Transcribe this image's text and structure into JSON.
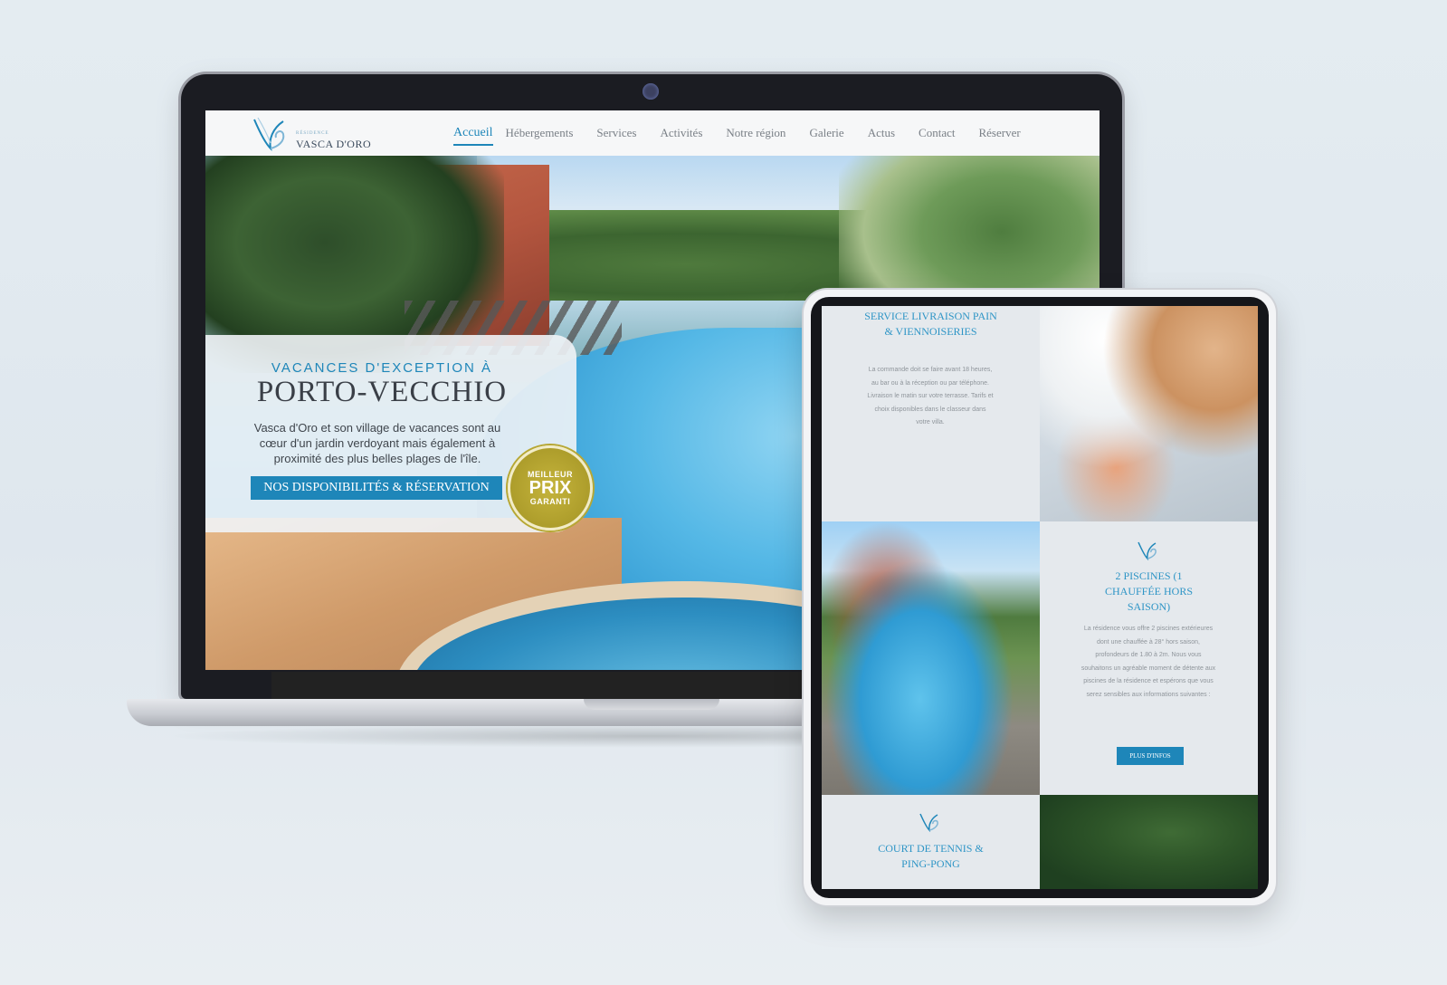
{
  "site": {
    "logo_small": "RÉSIDENCE",
    "logo_text": "VASCA D'ORO",
    "nav": [
      {
        "label": "Accueil",
        "active": true
      },
      {
        "label": "Hébergements"
      },
      {
        "label": "Services"
      },
      {
        "label": "Activités"
      },
      {
        "label": "Notre région"
      },
      {
        "label": "Galerie"
      },
      {
        "label": "Actus"
      },
      {
        "label": "Contact"
      },
      {
        "label": "Réserver"
      }
    ]
  },
  "hero": {
    "kicker": "VACANCES D'EXCEPTION À",
    "title": "PORTO-VECCHIO",
    "description": "Vasca d'Oro et son village de vacances sont au cœur d'un jardin verdoyant mais également à proximité des plus belles plages de l'île.",
    "cta": "NOS DISPONIBILITÉS & RÉSERVATION",
    "badge": {
      "top": "MEILLEUR",
      "mid": "PRIX",
      "bottom": "GARANTI"
    }
  },
  "tablet": {
    "service_bread": {
      "heading": "SERVICE LIVRAISON PAIN & VIENNOISERIES",
      "body": "La commande doit se faire avant 18 heures, au bar ou à la réception ou par téléphone. Livraison le matin sur votre terrasse. Tarifs et choix disponibles dans le classeur dans votre villa."
    },
    "pools": {
      "heading": "2 PISCINES (1 CHAUFFÉE HORS SAISON)",
      "body": "La résidence vous offre 2 piscines extérieures dont une chauffée à 28° hors saison, profondeurs de 1.80 à 2m. Nous vous souhaitons un agréable moment de détente aux piscines de la résidence et espérons que vous serez sensibles aux informations suivantes :",
      "button": "PLUS D'INFOS"
    },
    "tennis": {
      "heading": "COURT DE TENNIS & PING-PONG"
    }
  },
  "colors": {
    "accent": "#1e86b9",
    "badge_gold": "#ad9d2b",
    "bezel": "#1b1c22"
  }
}
